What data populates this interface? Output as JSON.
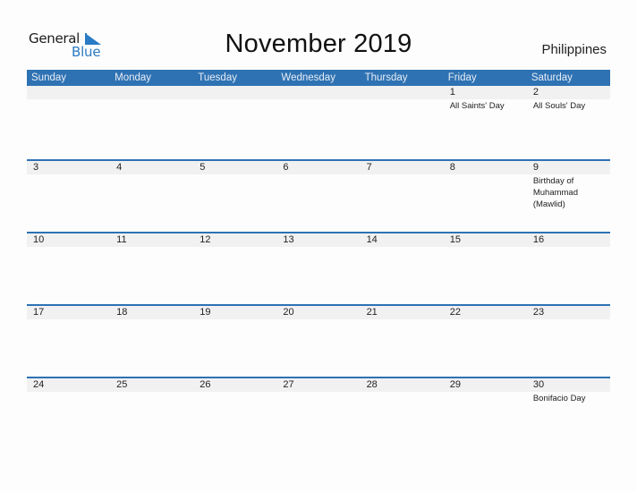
{
  "logo": {
    "word1": "General",
    "word2": "Blue",
    "icon": "triangle-flag-icon"
  },
  "title": "November 2019",
  "country": "Philippines",
  "colors": {
    "header_bg": "#2e72b3",
    "date_row_bg": "#f1f1f1",
    "logo_blue": "#2a7bc4"
  },
  "weekdays": [
    "Sunday",
    "Monday",
    "Tuesday",
    "Wednesday",
    "Thursday",
    "Friday",
    "Saturday"
  ],
  "weeks": [
    {
      "days": [
        "",
        "",
        "",
        "",
        "",
        "1",
        "2"
      ],
      "events": [
        "",
        "",
        "",
        "",
        "",
        "All Saints' Day",
        "All Souls' Day"
      ]
    },
    {
      "days": [
        "3",
        "4",
        "5",
        "6",
        "7",
        "8",
        "9"
      ],
      "events": [
        "",
        "",
        "",
        "",
        "",
        "",
        "Birthday of\nMuhammad\n(Mawlid)"
      ]
    },
    {
      "days": [
        "10",
        "11",
        "12",
        "13",
        "14",
        "15",
        "16"
      ],
      "events": [
        "",
        "",
        "",
        "",
        "",
        "",
        ""
      ]
    },
    {
      "days": [
        "17",
        "18",
        "19",
        "20",
        "21",
        "22",
        "23"
      ],
      "events": [
        "",
        "",
        "",
        "",
        "",
        "",
        ""
      ]
    },
    {
      "days": [
        "24",
        "25",
        "26",
        "27",
        "28",
        "29",
        "30"
      ],
      "events": [
        "",
        "",
        "",
        "",
        "",
        "",
        "Bonifacio Day"
      ]
    }
  ]
}
